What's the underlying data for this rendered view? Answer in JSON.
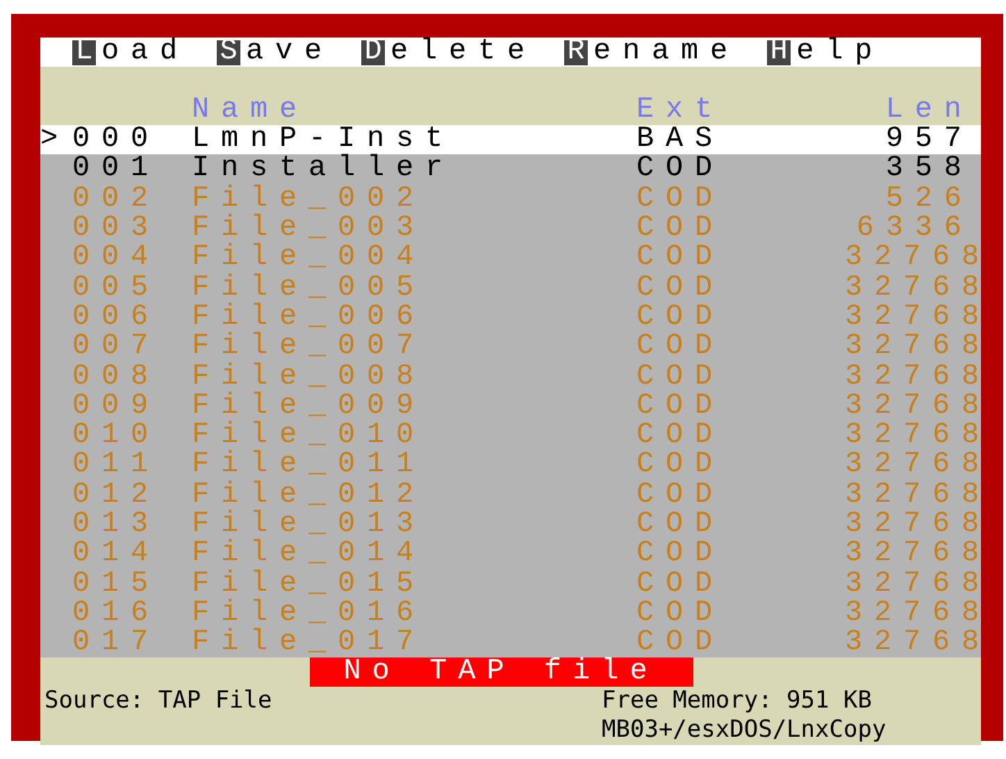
{
  "menu": [
    {
      "key": "L",
      "label": "oad"
    },
    {
      "key": "S",
      "label": "ave"
    },
    {
      "key": "D",
      "label": "elete"
    },
    {
      "key": "R",
      "label": "ename"
    },
    {
      "key": "H",
      "label": "elp"
    }
  ],
  "table": {
    "cursor": ">",
    "columns": [
      "Name",
      "Ext",
      "Len"
    ],
    "rows": [
      {
        "number": "000",
        "name": "LmnP-Inst",
        "ext": "BAS",
        "len": "957",
        "selected": true,
        "color": "#000000"
      },
      {
        "number": "001",
        "name": "Installer",
        "ext": "COD",
        "len": "358",
        "selected": false,
        "color": "#000000"
      },
      {
        "number": "002",
        "name": "File_002",
        "ext": "COD",
        "len": "526",
        "selected": false,
        "color": "#c8801e"
      },
      {
        "number": "003",
        "name": "File_003",
        "ext": "COD",
        "len": "6336",
        "selected": false,
        "color": "#c8801e"
      },
      {
        "number": "004",
        "name": "File_004",
        "ext": "COD",
        "len": "32768",
        "selected": false,
        "color": "#c8801e"
      },
      {
        "number": "005",
        "name": "File_005",
        "ext": "COD",
        "len": "32768",
        "selected": false,
        "color": "#c8801e"
      },
      {
        "number": "006",
        "name": "File_006",
        "ext": "COD",
        "len": "32768",
        "selected": false,
        "color": "#c8801e"
      },
      {
        "number": "007",
        "name": "File_007",
        "ext": "COD",
        "len": "32768",
        "selected": false,
        "color": "#c8801e"
      },
      {
        "number": "008",
        "name": "File_008",
        "ext": "COD",
        "len": "32768",
        "selected": false,
        "color": "#c8801e"
      },
      {
        "number": "009",
        "name": "File_009",
        "ext": "COD",
        "len": "32768",
        "selected": false,
        "color": "#c8801e"
      },
      {
        "number": "010",
        "name": "File_010",
        "ext": "COD",
        "len": "32768",
        "selected": false,
        "color": "#c8801e"
      },
      {
        "number": "011",
        "name": "File_011",
        "ext": "COD",
        "len": "32768",
        "selected": false,
        "color": "#c8801e"
      },
      {
        "number": "012",
        "name": "File_012",
        "ext": "COD",
        "len": "32768",
        "selected": false,
        "color": "#c8801e"
      },
      {
        "number": "013",
        "name": "File_013",
        "ext": "COD",
        "len": "32768",
        "selected": false,
        "color": "#c8801e"
      },
      {
        "number": "014",
        "name": "File_014",
        "ext": "COD",
        "len": "32768",
        "selected": false,
        "color": "#c8801e"
      },
      {
        "number": "015",
        "name": "File_015",
        "ext": "COD",
        "len": "32768",
        "selected": false,
        "color": "#c8801e"
      },
      {
        "number": "016",
        "name": "File_016",
        "ext": "COD",
        "len": "32768",
        "selected": false,
        "color": "#c8801e"
      },
      {
        "number": "017",
        "name": "File_017",
        "ext": "COD",
        "len": "32768",
        "selected": false,
        "color": "#c8801e"
      }
    ]
  },
  "banner": "No TAP file",
  "status": {
    "source": "Source: TAP File",
    "memory": "Free Memory: 951 KB",
    "program": "MB03+/esxDOS/LnxCopy"
  }
}
